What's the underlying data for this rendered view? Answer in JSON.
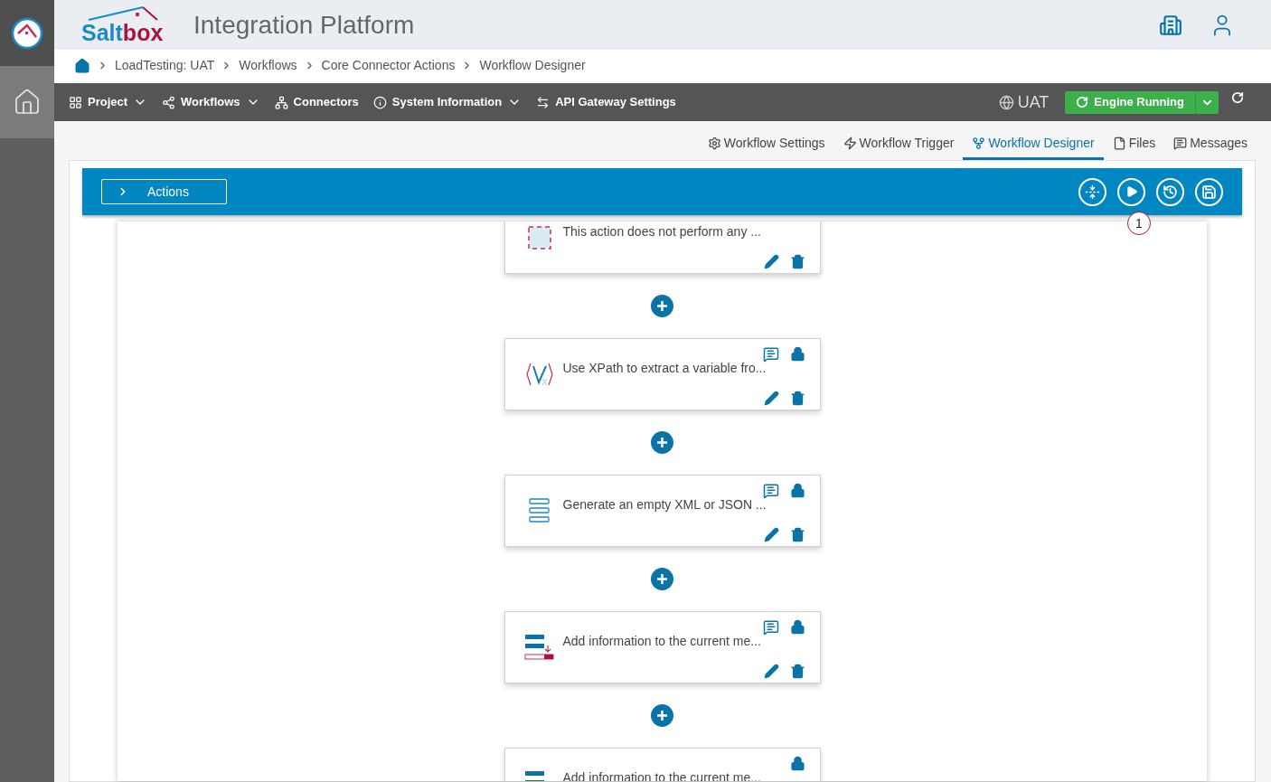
{
  "header": {
    "logo_parts": [
      "Salt",
      "box"
    ],
    "title": "Integration Platform"
  },
  "breadcrumb": [
    "LoadTesting: UAT",
    "Workflows",
    "Core Connector Actions",
    "Workflow Designer"
  ],
  "nav": {
    "items": [
      {
        "label": "Project",
        "dropdown": true
      },
      {
        "label": "Workflows",
        "dropdown": true
      },
      {
        "label": "Connectors",
        "dropdown": false
      },
      {
        "label": "System Information",
        "dropdown": true
      },
      {
        "label": "API Gateway Settings",
        "dropdown": false
      }
    ],
    "environment": "UAT",
    "engine_status": "Engine Running"
  },
  "tabs": [
    {
      "label": "Workflow Settings",
      "selected": false
    },
    {
      "label": "Workflow Trigger",
      "selected": false
    },
    {
      "label": "Workflow Designer",
      "selected": true
    },
    {
      "label": "Files",
      "selected": false
    },
    {
      "label": "Messages",
      "selected": false
    }
  ],
  "toolbar": {
    "actions_label": "Actions",
    "step_badge": "1"
  },
  "cards": [
    {
      "kind": "noop",
      "text": "This action does not perform any ...",
      "commented": false,
      "locked": false,
      "edit_tools": true
    },
    {
      "kind": "xpath",
      "text": "Use XPath to extract a variable fro...",
      "commented": true,
      "locked": true,
      "edit_tools": true
    },
    {
      "kind": "template",
      "text": "Generate an empty XML or JSON ...",
      "commented": true,
      "locked": true,
      "edit_tools": true
    },
    {
      "kind": "add-info",
      "text": "Add information to the current me...",
      "commented": true,
      "locked": true,
      "edit_tools": true
    },
    {
      "kind": "add-info",
      "text": "Add information to the current me...",
      "commented": false,
      "locked": true,
      "edit_tools": false
    }
  ]
}
